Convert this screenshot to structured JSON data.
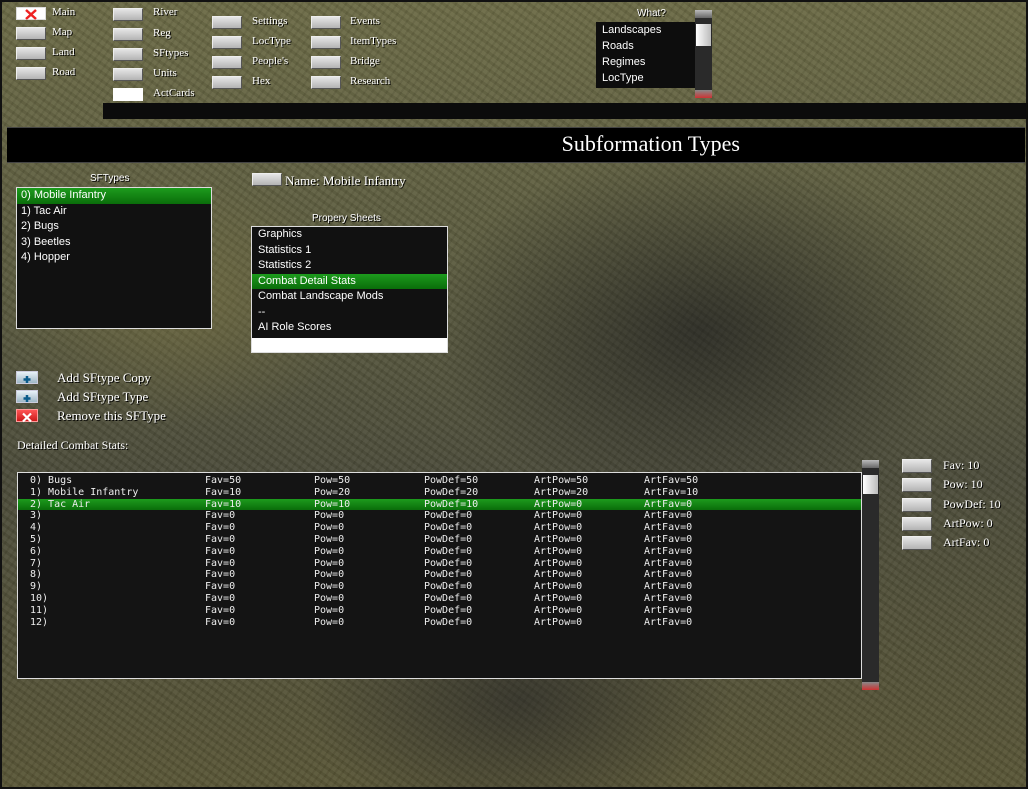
{
  "menu": {
    "col1": [
      "Main",
      "Map",
      "Land",
      "Road"
    ],
    "col2": [
      "River",
      "Reg",
      "SFtypes",
      "Units",
      "ActCards"
    ],
    "col3": [
      "Settings",
      "LocType",
      "People's",
      "Hex"
    ],
    "col4": [
      "Events",
      "ItemTypes",
      "Bridge",
      "Research"
    ]
  },
  "what": {
    "label": "What?",
    "items": [
      "Landscapes",
      "Roads",
      "Regimes",
      "LocType"
    ]
  },
  "page_title": "Subformation Types",
  "sftypes": {
    "header": "SFTypes",
    "items": [
      "0) Mobile Infantry",
      "1) Tac Air",
      "2) Bugs",
      "3) Beetles",
      "4) Hopper"
    ],
    "selected_index": 0
  },
  "name_field": {
    "text": "Name: Mobile Infantry"
  },
  "property_sheets": {
    "header": "Propery Sheets",
    "items": [
      "Graphics",
      "Statistics 1",
      "Statistics 2",
      "Combat Detail Stats",
      "Combat Landscape Mods",
      "--",
      "AI Role Scores"
    ],
    "selected_index": 3
  },
  "actions": {
    "add_copy": "Add SFtype Copy",
    "add_type": "Add SFtype Type",
    "remove": "Remove this SFType"
  },
  "detail_label": "Detailed Combat Stats:",
  "combat_stats": {
    "selected_index": 2,
    "rows": [
      [
        "0)  Bugs",
        "Fav=50",
        "Pow=50",
        "PowDef=50",
        "ArtPow=50",
        "ArtFav=50"
      ],
      [
        "1)  Mobile Infantry",
        "Fav=10",
        "Pow=20",
        "PowDef=20",
        "ArtPow=20",
        "ArtFav=10"
      ],
      [
        "2)  Tac Air",
        "Fav=10",
        "Pow=10",
        "PowDef=10",
        "ArtPow=0",
        "ArtFav=0"
      ],
      [
        "3)",
        "Fav=0",
        "Pow=0",
        "PowDef=0",
        "ArtPow=0",
        "ArtFav=0"
      ],
      [
        "4)",
        "Fav=0",
        "Pow=0",
        "PowDef=0",
        "ArtPow=0",
        "ArtFav=0"
      ],
      [
        "5)",
        "Fav=0",
        "Pow=0",
        "PowDef=0",
        "ArtPow=0",
        "ArtFav=0"
      ],
      [
        "6)",
        "Fav=0",
        "Pow=0",
        "PowDef=0",
        "ArtPow=0",
        "ArtFav=0"
      ],
      [
        "7)",
        "Fav=0",
        "Pow=0",
        "PowDef=0",
        "ArtPow=0",
        "ArtFav=0"
      ],
      [
        "8)",
        "Fav=0",
        "Pow=0",
        "PowDef=0",
        "ArtPow=0",
        "ArtFav=0"
      ],
      [
        "9)",
        "Fav=0",
        "Pow=0",
        "PowDef=0",
        "ArtPow=0",
        "ArtFav=0"
      ],
      [
        "10)",
        "Fav=0",
        "Pow=0",
        "PowDef=0",
        "ArtPow=0",
        "ArtFav=0"
      ],
      [
        "11)",
        "Fav=0",
        "Pow=0",
        "PowDef=0",
        "ArtPow=0",
        "ArtFav=0"
      ],
      [
        "12)",
        "Fav=0",
        "Pow=0",
        "PowDef=0",
        "ArtPow=0",
        "ArtFav=0"
      ]
    ]
  },
  "stat_buttons": [
    "Fav: 10",
    "Pow: 10",
    "PowDef: 10",
    "ArtPow: 0",
    "ArtFav: 0"
  ]
}
